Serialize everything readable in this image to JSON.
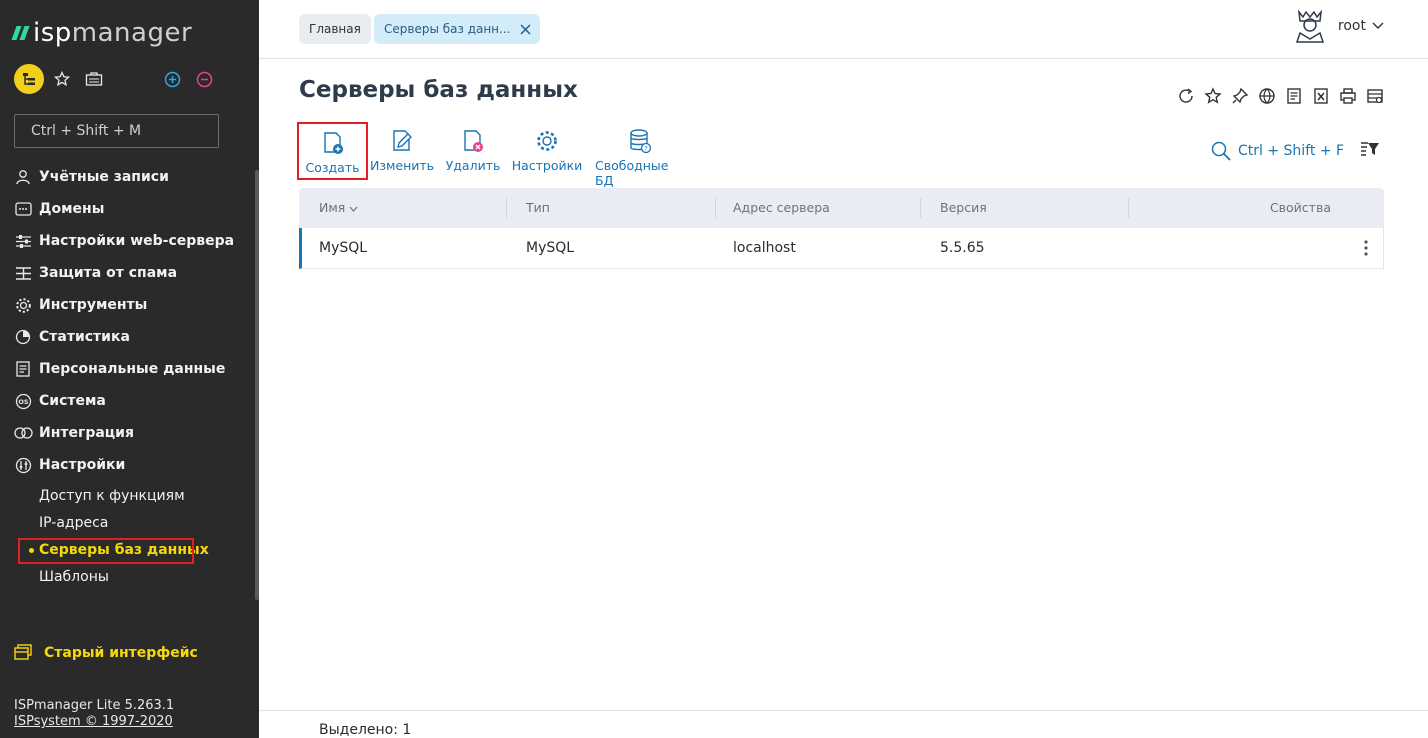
{
  "sidebar": {
    "logo": {
      "prefix": "isp",
      "suffix": "manager"
    },
    "search_placeholder": "Ctrl + Shift + M",
    "nav_items": [
      {
        "label": "Учётные записи",
        "icon": "user-icon"
      },
      {
        "label": "Домены",
        "icon": "domain-icon"
      },
      {
        "label": "Настройки web-сервера",
        "icon": "sliders-icon"
      },
      {
        "label": "Защита от спама",
        "icon": "spam-filter-icon"
      },
      {
        "label": "Инструменты",
        "icon": "gear-icon"
      },
      {
        "label": "Статистика",
        "icon": "pie-chart-icon"
      },
      {
        "label": "Персональные данные",
        "icon": "personal-data-icon"
      },
      {
        "label": "Система",
        "icon": "os-icon"
      },
      {
        "label": "Интеграция",
        "icon": "integration-icon"
      },
      {
        "label": "Настройки",
        "icon": "settings-icon"
      }
    ],
    "sub_items": [
      {
        "label": "Доступ к функциям",
        "active": false
      },
      {
        "label": "IP-адреса",
        "active": false
      },
      {
        "label": "Серверы баз данных",
        "active": true
      },
      {
        "label": "Шаблоны",
        "active": false
      }
    ],
    "old_ui_label": "Старый интерфейс",
    "version_line": "ISPmanager Lite 5.263.1",
    "copyright_line": "ISPsystem © 1997-2020"
  },
  "topbar": {
    "breadcrumbs": [
      "Главная",
      "Серверы баз данн..."
    ],
    "user": "root"
  },
  "main": {
    "title": "Серверы баз данных",
    "toolbar": {
      "create": "Создать",
      "edit": "Изменить",
      "delete": "Удалить",
      "settings": "Настройки",
      "free_db": "Свободные БД"
    },
    "find_shortcut": "Ctrl + Shift + F",
    "table": {
      "columns": [
        "Имя",
        "Тип",
        "Адрес сервера",
        "Версия",
        "Свойства"
      ],
      "rows": [
        {
          "name": "MySQL",
          "type": "MySQL",
          "address": "localhost",
          "version": "5.5.65"
        }
      ]
    },
    "status": "Выделено: 1"
  },
  "colors": {
    "sidebar_bg": "#2a2a2b",
    "accent_yellow": "#f5d90a",
    "accent_blue": "#1874b3",
    "logo_green": "#2fd9a6",
    "highlight_red": "#e31e24"
  }
}
